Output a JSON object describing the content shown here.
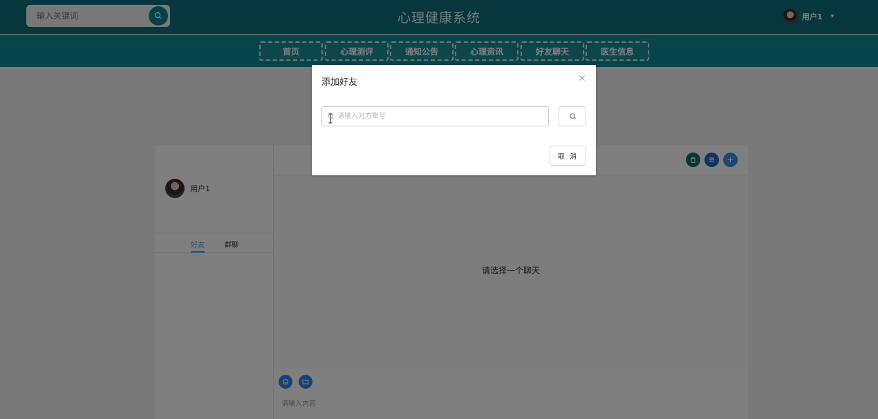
{
  "header": {
    "search_placeholder": "输入关键词",
    "site_title": "心理健康系统",
    "user_name": "用户1",
    "search_icon": "search-icon",
    "dropdown_icon": "caret-down-icon"
  },
  "nav": {
    "items": [
      {
        "label": "首页"
      },
      {
        "label": "心理测评"
      },
      {
        "label": "通知公告"
      },
      {
        "label": "心理资讯"
      },
      {
        "label": "好友聊天"
      },
      {
        "label": "医生信息"
      }
    ]
  },
  "chat": {
    "user_name": "用户1",
    "tabs": [
      {
        "label": "好友",
        "active": true
      },
      {
        "label": "群聊",
        "active": false
      }
    ],
    "empty_tip": "请选择一个聊天",
    "input_placeholder": "请输入内容",
    "header_actions": [
      "delete-icon",
      "list-icon",
      "plus-icon"
    ],
    "tools": [
      "emoji-icon",
      "folder-icon"
    ]
  },
  "dialog": {
    "title": "添加好友",
    "input_placeholder": "请输入对方账号",
    "cancel_label": "取 消",
    "close_icon": "close-icon",
    "search_icon": "search-icon"
  },
  "colors": {
    "header_bg": "#0a6e78",
    "nav_bg": "#0c8a94",
    "accent": "#409eff",
    "tool_blue": "#2f86e8"
  }
}
